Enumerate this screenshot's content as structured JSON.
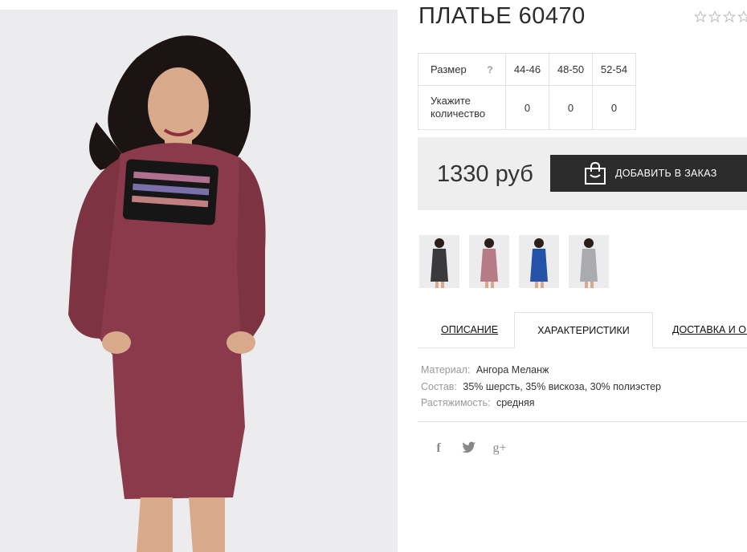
{
  "product": {
    "title": "ПЛАТЬЕ 60470",
    "rating_stars": 5
  },
  "size_table": {
    "header_label": "Размер",
    "help_icon": "?",
    "sizes": [
      "44-46",
      "48-50",
      "52-54"
    ],
    "qty_label_line1": "Укажите",
    "qty_label_line2": "количество",
    "quantities": [
      "0",
      "0",
      "0"
    ]
  },
  "price": {
    "value": "1330 руб",
    "order_label": "ДОБАВИТЬ В ЗАКАЗ",
    "order_icon": "shopping-bag-icon"
  },
  "thumbnails": [
    {
      "name": "dark-gray"
    },
    {
      "name": "burgundy"
    },
    {
      "name": "blue"
    },
    {
      "name": "light-gray"
    }
  ],
  "tabs": [
    {
      "label": "ОПИСАНИЕ",
      "active": false
    },
    {
      "label": "ХАРАКТЕРИСТИКИ",
      "active": true
    },
    {
      "label": "ДОСТАВКА И ОПЛАТА",
      "active": false
    }
  ],
  "specs": [
    {
      "key": "Материал:",
      "value": "Ангора Меланж"
    },
    {
      "key": "Состав:",
      "value": "35% шерсть, 35% вискоза, 30% полиэстер"
    },
    {
      "key": "Растяжимость:",
      "value": "средняя"
    }
  ],
  "social": {
    "facebook": "f",
    "twitter": "twitter-icon",
    "googleplus": "g+"
  },
  "colors": {
    "dress_burgundy": "#8a3a4a",
    "button_dark": "#2c2c2c",
    "price_bg": "#eeeeee"
  }
}
